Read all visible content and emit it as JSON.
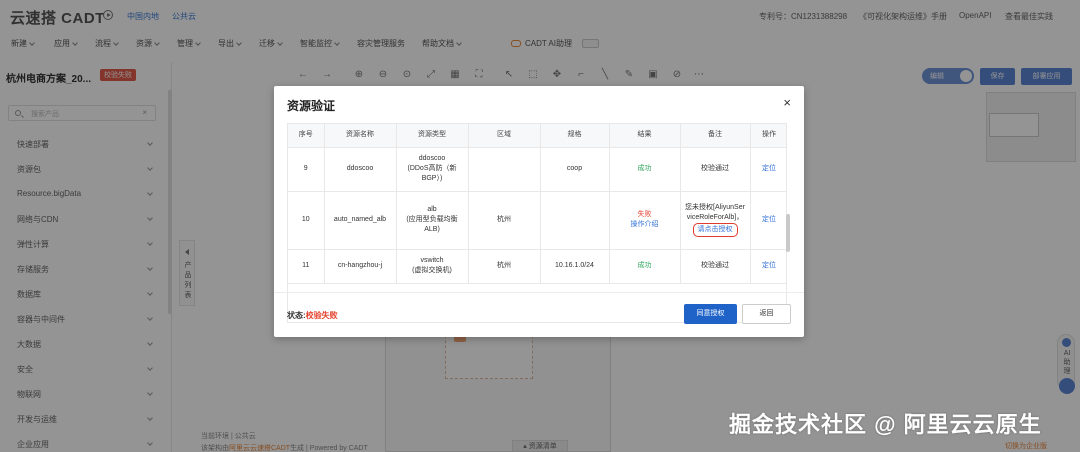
{
  "app": {
    "logo": "云速搭 CADT",
    "regions": [
      "中国内地",
      "公共云"
    ],
    "patent": "专利号：CN1231388298",
    "top_links": [
      "《可视化架构运维》手册",
      "OpenAPI",
      "查看最佳实践"
    ],
    "menu": [
      "新建",
      "应用",
      "流程",
      "资源",
      "管理",
      "导出",
      "迁移",
      "智能监控",
      "容灾管理服务",
      "帮助文档"
    ],
    "ai_assistant": "CADT AI助理",
    "project_title": "杭州电商方案_20...",
    "project_badge": "校验失败",
    "search_placeholder": "搜索产品",
    "sidebar_items": [
      "快速部署",
      "资源包",
      "Resource.bigData",
      "网络与CDN",
      "弹性计算",
      "存储服务",
      "数据库",
      "容器与中间件",
      "大数据",
      "安全",
      "物联网",
      "开发与运维",
      "企业应用"
    ],
    "collapse_label": "产品列表",
    "edit_label": "编辑",
    "save_label": "保存",
    "deploy_label": "部署应用",
    "footer_env": "当前环境 | 公共云",
    "footer_gen_prefix": "该架构由",
    "footer_gen_link": "阿里云云速搭CADT",
    "footer_gen_suffix": "生成 | Powered by CADT",
    "resource_list": "资源清单",
    "right_ai": "AI助理",
    "watermark": "掘金技术社区 @ 阿里云云原生",
    "bottom_hint": "切换为企业版"
  },
  "modal": {
    "title": "资源验证",
    "close": "×",
    "columns": [
      "序号",
      "资源名称",
      "资源类型",
      "区域",
      "规格",
      "结果",
      "备注",
      "操作"
    ],
    "rows": [
      {
        "no": "9",
        "name": "ddoscoo",
        "type": "ddoscoo\n(DDoS高防（新BGP）)",
        "region": "",
        "spec": "coop",
        "result": "成功",
        "result_link": "",
        "note": "校验通过",
        "note_link": "",
        "action": "定位",
        "status": "ok"
      },
      {
        "no": "10",
        "name": "auto_named_alb",
        "type": "alb\n(应用型负载均衡ALB)",
        "region": "杭州",
        "spec": "",
        "result": "失败",
        "result_link": "操作介绍",
        "note": "您未授权[AliyunServiceRoleForAlb]，",
        "note_link": "请点击授权",
        "action": "定位",
        "status": "fail"
      },
      {
        "no": "11",
        "name": "cn-hangzhou-j",
        "type": "vswitch\n(虚拟交换机)",
        "region": "杭州",
        "spec": "10.16.1.0/24",
        "result": "成功",
        "result_link": "",
        "note": "校验通过",
        "note_link": "",
        "action": "定位",
        "status": "ok"
      }
    ],
    "status_label": "状态:",
    "status_value": "校验失败",
    "agree_button": "同意授权",
    "back_button": "返回"
  }
}
